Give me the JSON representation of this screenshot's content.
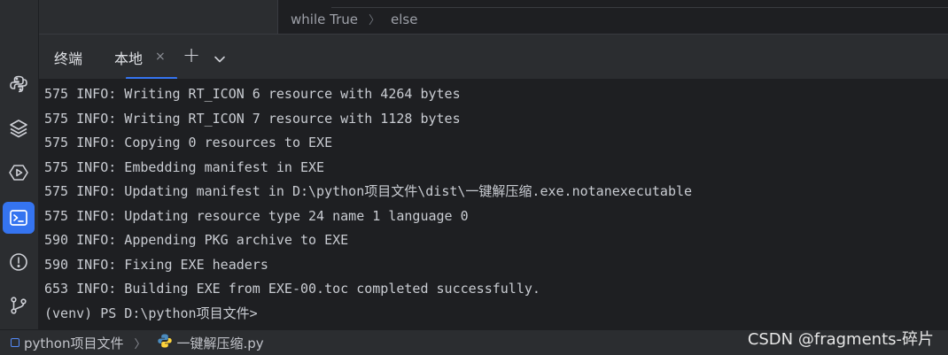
{
  "editor": {
    "breadcrumb": [
      "while True",
      "else"
    ]
  },
  "terminal": {
    "tabs": [
      {
        "label": "终端",
        "active": false
      },
      {
        "label": "本地",
        "active": true
      }
    ],
    "close_glyph": "×",
    "add_glyph": "+",
    "lines": [
      "575 INFO: Writing RT_ICON 6 resource with 4264 bytes",
      "575 INFO: Writing RT_ICON 7 resource with 1128 bytes",
      "575 INFO: Copying 0 resources to EXE",
      "575 INFO: Embedding manifest in EXE",
      "575 INFO: Updating manifest in D:\\python项目文件\\dist\\一键解压缩.exe.notanexecutable",
      "575 INFO: Updating resource type 24 name 1 language 0",
      "590 INFO: Appending PKG archive to EXE",
      "590 INFO: Fixing EXE headers",
      "653 INFO: Building EXE from EXE-00.toc completed successfully.",
      "(venv) PS D:\\python项目文件>"
    ]
  },
  "toolstrip": {
    "icons": [
      "python-console-icon",
      "layers-icon",
      "run-icon",
      "terminal-icon",
      "problems-icon",
      "git-icon"
    ],
    "active": "terminal-icon",
    "accent": "#3574f0"
  },
  "statusbar": {
    "project": "python项目文件",
    "file": "一键解压缩.py"
  },
  "watermark": "CSDN @fragments-碎片"
}
